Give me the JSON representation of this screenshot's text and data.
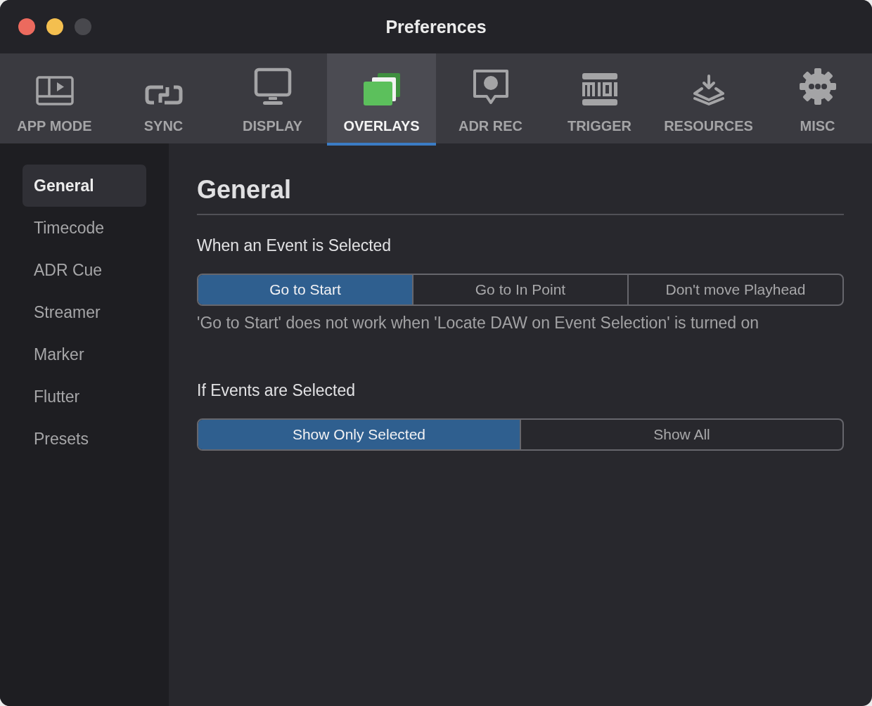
{
  "window": {
    "title": "Preferences",
    "lights": [
      {
        "kind": "close",
        "disabled": false
      },
      {
        "kind": "minimize",
        "disabled": false
      },
      {
        "kind": "zoom",
        "disabled": true
      }
    ]
  },
  "tabs": [
    {
      "label": "APP MODE",
      "selected": false
    },
    {
      "label": "SYNC",
      "selected": false
    },
    {
      "label": "DISPLAY",
      "selected": false
    },
    {
      "label": "OVERLAYS",
      "selected": true
    },
    {
      "label": "ADR REC",
      "selected": false
    },
    {
      "label": "TRIGGER",
      "selected": false
    },
    {
      "label": "RESOURCES",
      "selected": false
    },
    {
      "label": "MISC",
      "selected": false
    }
  ],
  "sidebar": {
    "items": [
      {
        "label": "General",
        "selected": true
      },
      {
        "label": "Timecode",
        "selected": false
      },
      {
        "label": "ADR Cue",
        "selected": false
      },
      {
        "label": "Streamer",
        "selected": false
      },
      {
        "label": "Marker",
        "selected": false
      },
      {
        "label": "Flutter",
        "selected": false
      },
      {
        "label": "Presets",
        "selected": false
      }
    ]
  },
  "content": {
    "heading": "General",
    "sections": [
      {
        "label": "When an Event is Selected",
        "options": [
          {
            "label": "Go to Start",
            "selected": true
          },
          {
            "label": "Go to In Point",
            "selected": false
          },
          {
            "label": "Don't move Playhead",
            "selected": false
          }
        ],
        "note": "'Go to Start' does not work when 'Locate DAW on Event Selection' is turned on"
      },
      {
        "label": "If Events are Selected",
        "options": [
          {
            "label": "Show Only Selected",
            "selected": true
          },
          {
            "label": "Show All",
            "selected": false
          }
        ]
      }
    ]
  }
}
